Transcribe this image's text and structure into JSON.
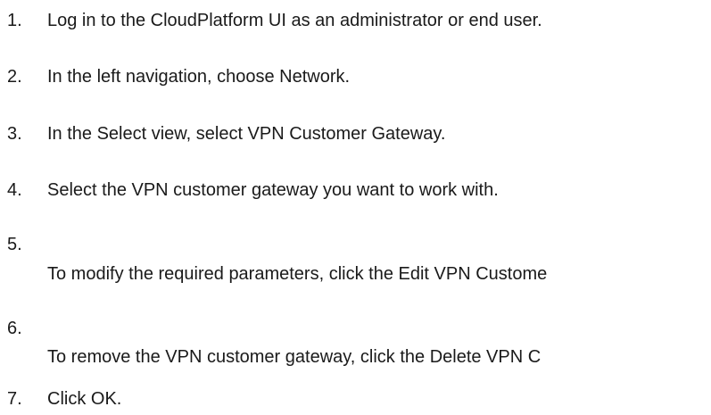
{
  "steps": [
    {
      "number": "1.",
      "text": "Log in to the CloudPlatform UI as an administrator or end user."
    },
    {
      "number": "2.",
      "text": "In the left navigation, choose Network."
    },
    {
      "number": "3.",
      "text": "In the Select view, select VPN Customer Gateway."
    },
    {
      "number": "4.",
      "text": "Select the VPN customer gateway you want to work with."
    },
    {
      "number": "5.",
      "text": "To modify the required parameters, click the Edit VPN Custome"
    },
    {
      "number": "6.",
      "text": "To remove the VPN customer gateway, click the Delete VPN C"
    },
    {
      "number": "7.",
      "text": "Click OK."
    }
  ]
}
